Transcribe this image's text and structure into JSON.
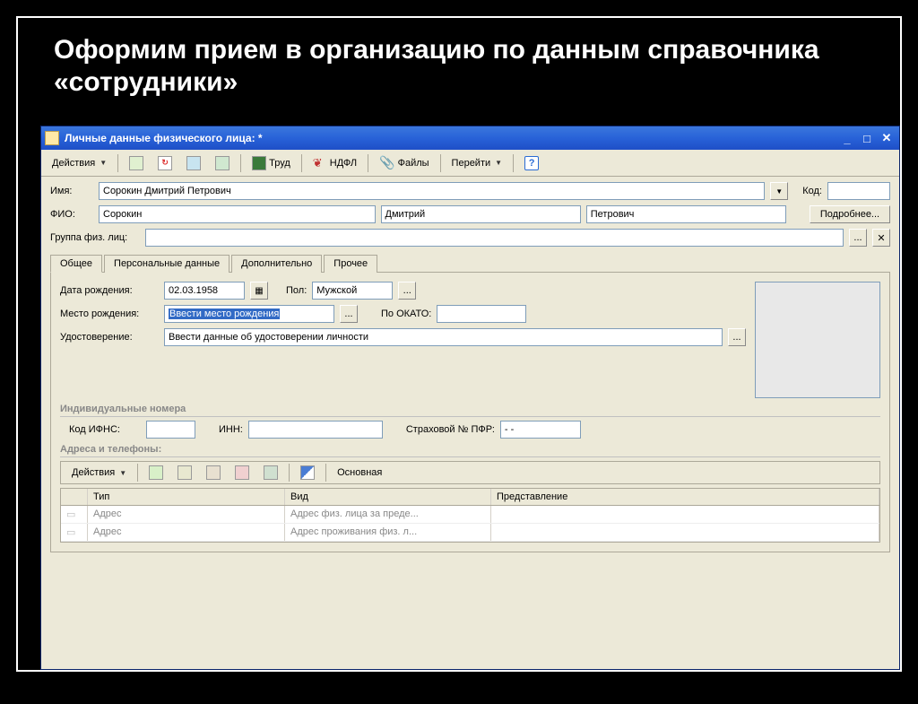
{
  "slide": {
    "title": "Оформим прием в организацию по данным справочника «сотрудники»"
  },
  "window": {
    "title": "Личные данные физического лица:   *"
  },
  "toolbar": {
    "actions": "Действия",
    "trud": "Труд",
    "ndfl": "НДФЛ",
    "files": "Файлы",
    "goto": "Перейти"
  },
  "form": {
    "name_label": "Имя:",
    "name_value": "Сорокин Дмитрий Петрович",
    "code_label": "Код:",
    "code_value": "",
    "fio_label": "ФИО:",
    "surname": "Сорокин",
    "firstname": "Дмитрий",
    "patronymic": "Петрович",
    "more_btn": "Подробнее...",
    "group_label": "Группа физ. лиц:",
    "group_value": ""
  },
  "tabs": {
    "general": "Общее",
    "personal": "Персональные данные",
    "additional": "Дополнительно",
    "other": "Прочее"
  },
  "general_tab": {
    "dob_label": "Дата рождения:",
    "dob_value": "02.03.1958",
    "gender_label": "Пол:",
    "gender_value": "Мужской",
    "birthplace_label": "Место рождения:",
    "birthplace_value": "Ввести место рождения",
    "okato_label": "По ОКАТО:",
    "okato_value": "",
    "id_label": "Удостоверение:",
    "id_value": "Ввести данные об удостоверении личности",
    "indiv_numbers": "Индивидуальные номера",
    "ifns_label": "Код ИФНС:",
    "ifns_value": "",
    "inn_label": "ИНН:",
    "inn_value": "",
    "pfr_label": "Страховой № ПФР:",
    "pfr_value": "-   -",
    "addresses_title": "Адреса и телефоны:"
  },
  "address_toolbar": {
    "actions": "Действия",
    "main": "Основная"
  },
  "address_table": {
    "headers": {
      "type": "Тип",
      "kind": "Вид",
      "repr": "Представление"
    },
    "rows": [
      {
        "type": "Адрес",
        "kind": "Адрес физ. лица за преде...",
        "repr": ""
      },
      {
        "type": "Адрес",
        "kind": "Адрес проживания физ. л...",
        "repr": ""
      }
    ]
  }
}
